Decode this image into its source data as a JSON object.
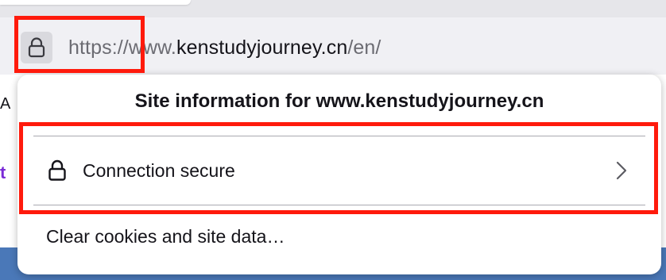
{
  "url_bar": {
    "scheme": "https://",
    "domain_prefix": "www.",
    "domain": "kenstudyjourney.cn",
    "path": "/en/"
  },
  "page_background": {
    "partial_letter": "A",
    "partial_link_char": "t"
  },
  "site_info_panel": {
    "title": "Site information for www.kenstudyjourney.cn",
    "connection_label": "Connection secure",
    "clear_label": "Clear cookies and site data…"
  },
  "colors": {
    "highlight": "#ff1a0c",
    "text": "#15141a",
    "muted_text": "#6b6b72",
    "toolbar": "#f0f0f4"
  },
  "icons": {
    "url_lock": "lock-icon",
    "connection": "lock-icon",
    "row_arrow": "chevron-right-icon"
  }
}
